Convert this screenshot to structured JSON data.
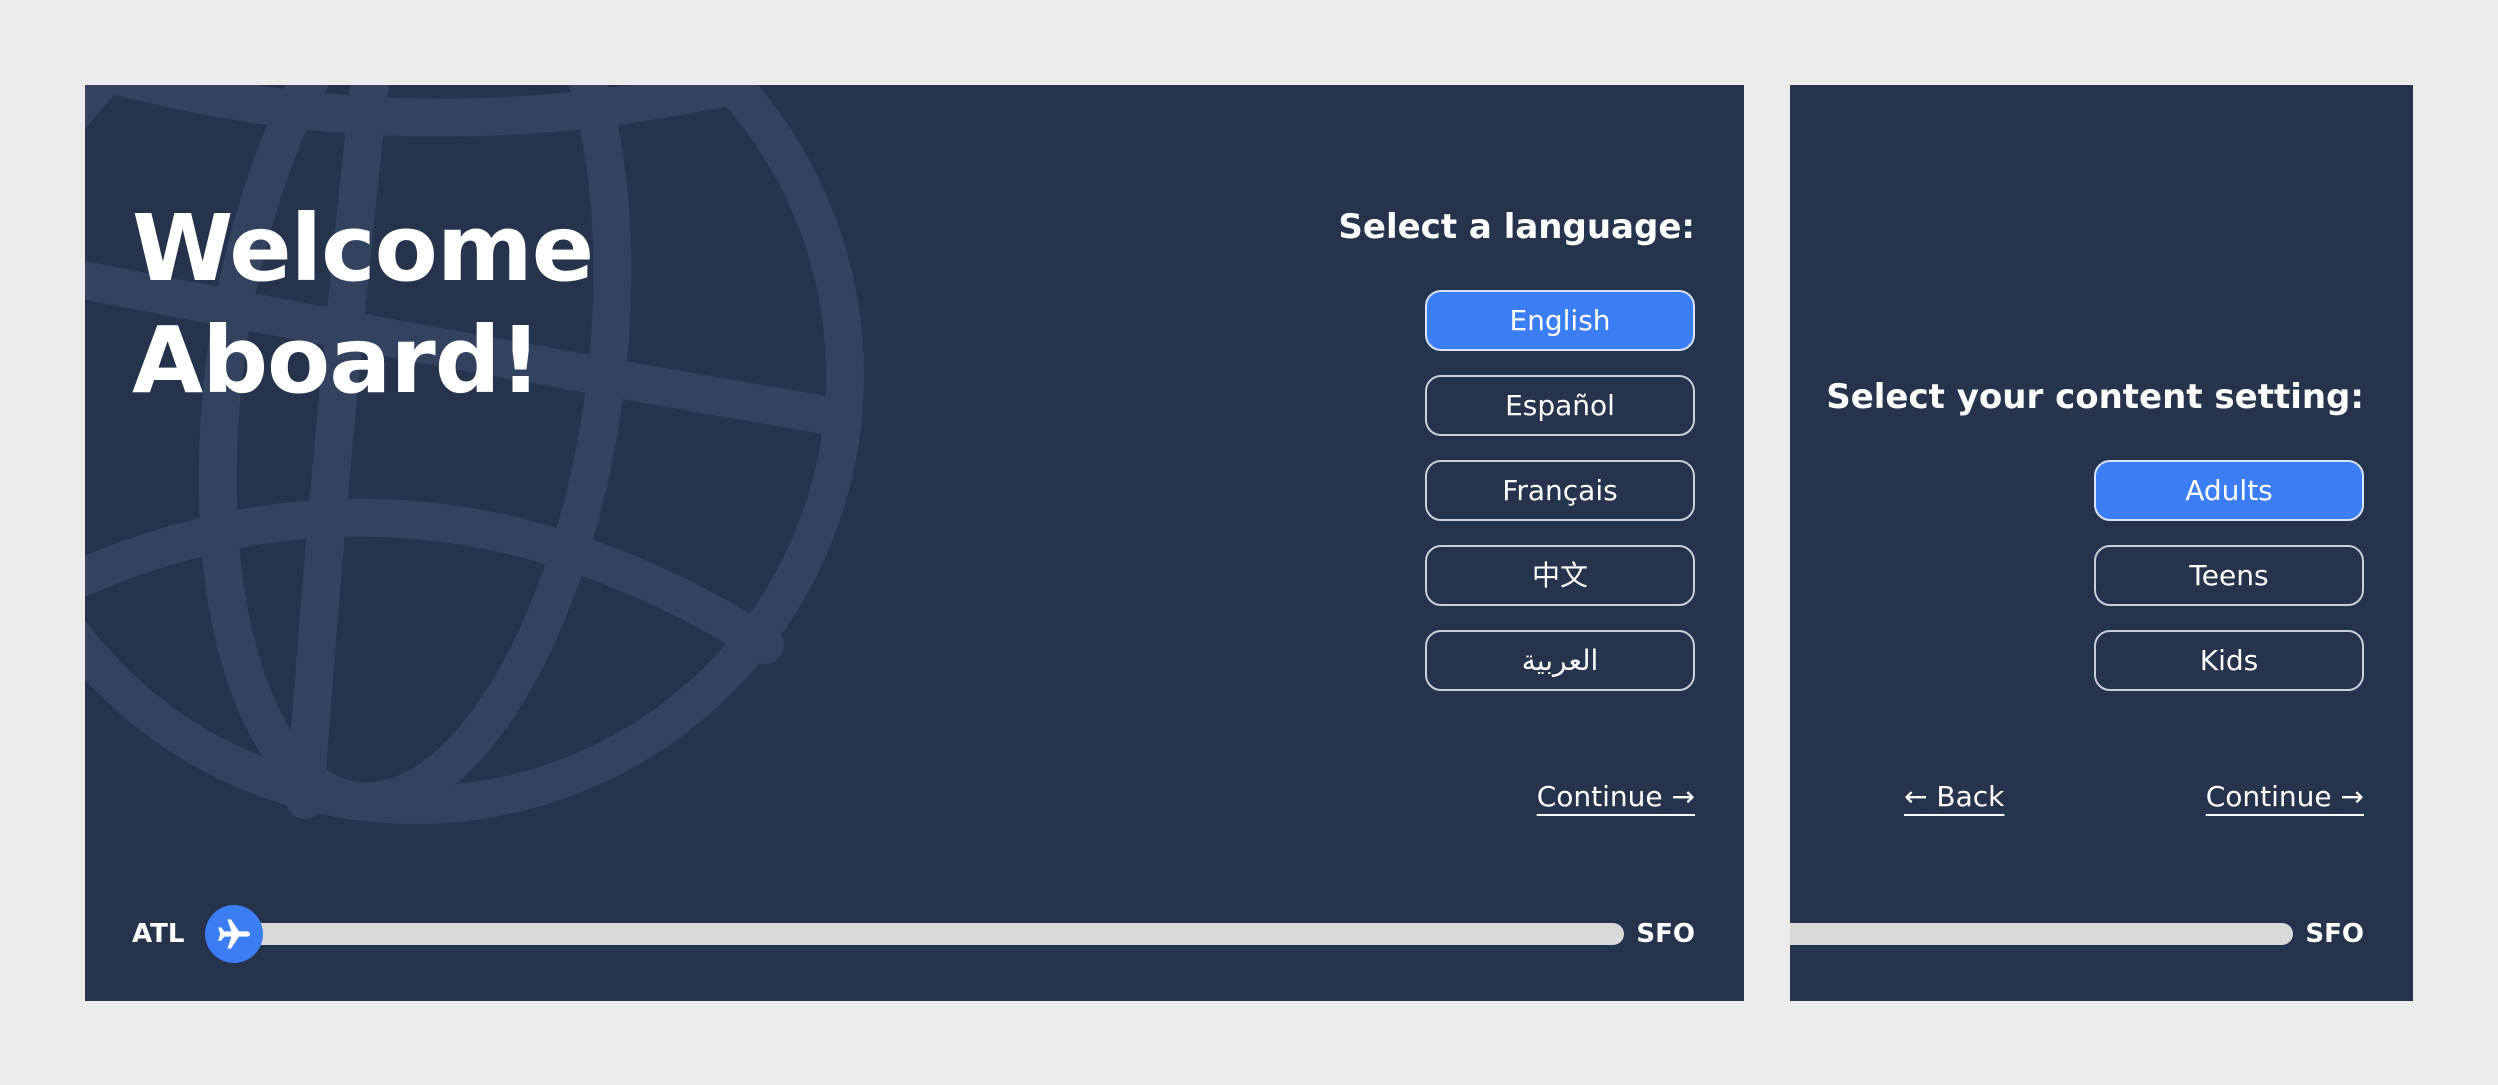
{
  "colors": {
    "page_background": "#ebebeb",
    "panel_background": "#26334d",
    "accent": "#3b7df2",
    "globe": "#33435f",
    "progress_track": "#d9d9d9",
    "text": "#ffffff"
  },
  "language_screen": {
    "welcome_line1": "Welcome",
    "welcome_line2": "Aboard!",
    "prompt": "Select a language:",
    "options": [
      "English",
      "Español",
      "Français",
      "中文",
      "العربية"
    ],
    "selected_index": 0,
    "continue_label": "Continue",
    "continue_arrow": "→",
    "flight": {
      "origin": "ATL",
      "destination": "SFO",
      "progress": 0.02
    },
    "background_icon": "globe-icon",
    "marker_icon": "airplane-icon"
  },
  "content_screen": {
    "prompt": "Select your content setting:",
    "options": [
      "Adults",
      "Teens",
      "Kids"
    ],
    "selected_index": 0,
    "back_arrow": "←",
    "back_label": "Back",
    "continue_label": "Continue",
    "continue_arrow": "→",
    "flight": {
      "destination": "SFO"
    }
  }
}
